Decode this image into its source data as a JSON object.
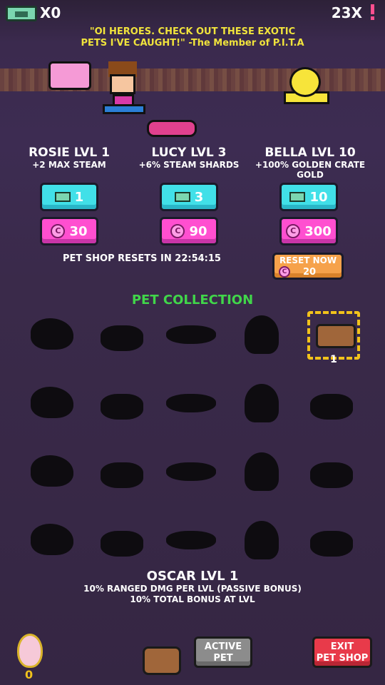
{
  "topbar": {
    "cash_count": "X0",
    "multiplier": "23X",
    "cash_icon": "cash-icon",
    "alert_icon": "exclamation-icon"
  },
  "quote": {
    "line1": "\"OI HEROES. CHECK OUT THESE EXOTIC",
    "line2": "PETS I'VE CAUGHT!\" -The Member of P.I.T.A"
  },
  "shop": {
    "pets": [
      {
        "name": "ROSIE LVL 1",
        "desc": "+2 MAX STEAM",
        "cash_price": "1",
        "gem_price": "30"
      },
      {
        "name": "LUCY LVL 3",
        "desc": "+6% STEAM SHARDS",
        "cash_price": "3",
        "gem_price": "90"
      },
      {
        "name": "BELLA LVL 10",
        "desc": "+100% GOLDEN CRATE GOLD",
        "cash_price": "10",
        "gem_price": "300"
      }
    ],
    "reset_label": "PET SHOP RESETS IN 22:54:15",
    "reset_button": {
      "label": "RESET NOW",
      "cost": "20"
    }
  },
  "collection": {
    "title": "PET COLLECTION",
    "selected_count": "1"
  },
  "selected_pet": {
    "name": "OSCAR LVL 1",
    "line1": "10% RANGED DMG PER LVL (PASSIVE BONUS)",
    "line2": "10% TOTAL BONUS AT LVL"
  },
  "footer": {
    "egg_count": "0",
    "active_pet_line1": "ACTIVE",
    "active_pet_line2": "PET",
    "exit_line1": "EXIT",
    "exit_line2": "PET SHOP"
  },
  "colors": {
    "gold": "#f0e33c",
    "green": "#41d64a",
    "cash": "#41e0e8",
    "gem": "#ff4fd0",
    "reset": "#f6a24b",
    "exit": "#e83a4a"
  }
}
